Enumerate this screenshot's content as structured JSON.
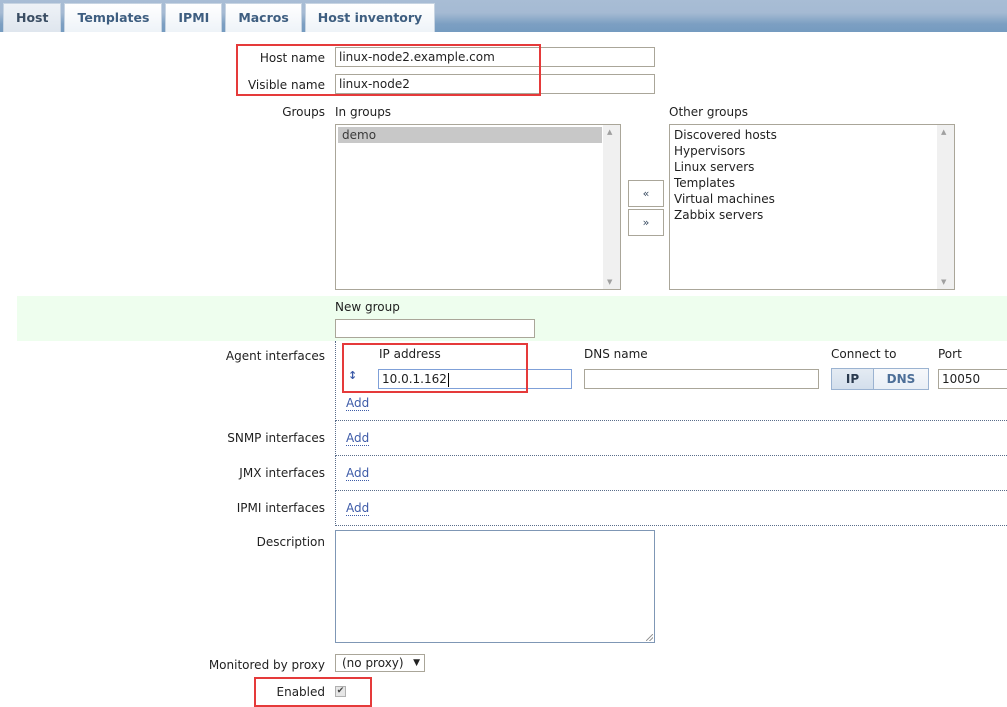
{
  "tabs": [
    {
      "label": "Host",
      "active": true
    },
    {
      "label": "Templates",
      "active": false
    },
    {
      "label": "IPMI",
      "active": false
    },
    {
      "label": "Macros",
      "active": false
    },
    {
      "label": "Host inventory",
      "active": false
    }
  ],
  "form": {
    "host_name": {
      "label": "Host name",
      "value": "linux-node2.example.com"
    },
    "visible_name": {
      "label": "Visible name",
      "value": "linux-node2"
    },
    "groups": {
      "label": "Groups",
      "in_groups_caption": "In groups",
      "in_groups": [
        "demo"
      ],
      "in_groups_selected": "demo",
      "other_groups_caption": "Other groups",
      "other_groups": [
        "Discovered hosts",
        "Hypervisors",
        "Linux servers",
        "Templates",
        "Virtual machines",
        "Zabbix servers"
      ],
      "move_left_label": "«",
      "move_right_label": "»"
    },
    "new_group": {
      "label": "New group",
      "value": ""
    },
    "agent_interfaces": {
      "label": "Agent interfaces",
      "columns": {
        "ip": "IP address",
        "dns": "DNS name",
        "connect_to": "Connect to",
        "port": "Port"
      },
      "rows": [
        {
          "ip": "10.0.1.162",
          "dns": "",
          "connect_to": "IP",
          "port": "10050"
        }
      ],
      "connect_options": [
        "IP",
        "DNS"
      ],
      "add_label": "Add"
    },
    "snmp_interfaces": {
      "label": "SNMP interfaces",
      "add_label": "Add"
    },
    "jmx_interfaces": {
      "label": "JMX interfaces",
      "add_label": "Add"
    },
    "ipmi_interfaces": {
      "label": "IPMI interfaces",
      "add_label": "Add"
    },
    "description": {
      "label": "Description",
      "value": ""
    },
    "proxy": {
      "label": "Monitored by proxy",
      "selected": "(no proxy)"
    },
    "enabled": {
      "label": "Enabled",
      "checked": true,
      "check_glyph": "✔"
    }
  },
  "icons": {
    "sort_handle": "↕",
    "dropdown_arrow": "▼",
    "scroll_up": "▲",
    "scroll_down": "▼"
  },
  "colors": {
    "highlight_box": "#e53a3a",
    "new_group_band": "#eefeee",
    "link": "#3d5ba8"
  }
}
